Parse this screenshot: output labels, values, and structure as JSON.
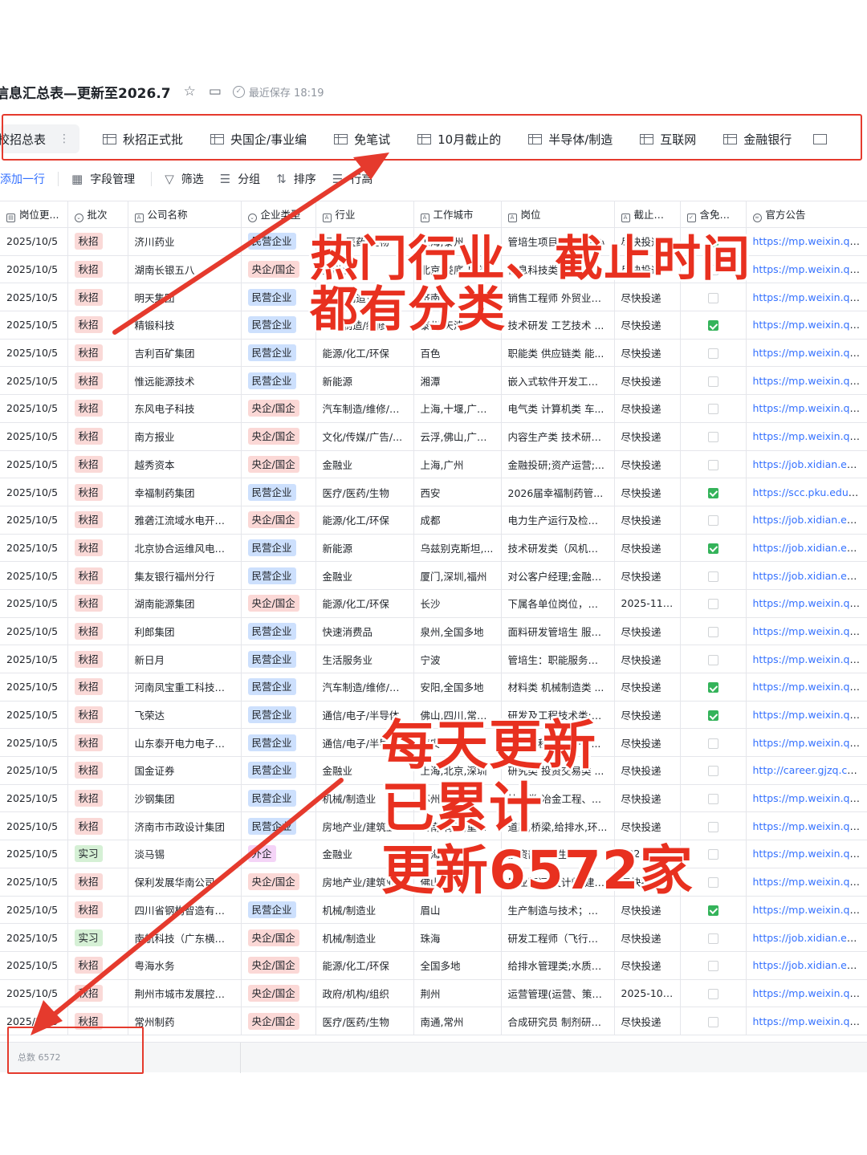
{
  "doc": {
    "title": "信息汇总表—更新至2026.7",
    "save_status": "最近保存 18:19"
  },
  "tabs": [
    {
      "label": "校招总表",
      "active": true
    },
    {
      "label": "秋招正式批"
    },
    {
      "label": "央国企/事业编"
    },
    {
      "label": "免笔试"
    },
    {
      "label": "10月截止的"
    },
    {
      "label": "半导体/制造"
    },
    {
      "label": "互联网"
    },
    {
      "label": "金融银行"
    }
  ],
  "toolbar": {
    "add_row": "添加一行",
    "field_manage": "字段管理",
    "filter": "筛选",
    "group": "分组",
    "sort": "排序",
    "row_height": "行高"
  },
  "columns": [
    "岗位更...",
    "批次",
    "公司名称",
    "企业类型",
    "行业",
    "工作城市",
    "岗位",
    "截止时间",
    "含免笔试",
    "官方公告"
  ],
  "rows": [
    {
      "date": "2025/10/5",
      "batch": "秋招",
      "company": "济川药业",
      "type": "民营企业",
      "industry": "医疗/医药/生物",
      "city": "上海,泰州",
      "position": "管培生项目; 生产中心",
      "deadline": "尽快投递",
      "free": true,
      "link": "https://mp.weixin.qq...."
    },
    {
      "date": "2025/10/5",
      "batch": "秋招",
      "company": "湖南长银五八",
      "type": "央企/国企",
      "industry": "金融业",
      "city": "北京,娄底,岳阳",
      "position": "信息科技类校招",
      "deadline": "尽快投递",
      "free": false,
      "link": "https://mp.weixin.qq...."
    },
    {
      "date": "2025/10/5",
      "batch": "秋招",
      "company": "明天集团",
      "type": "民营企业",
      "industry": "机械/制造业",
      "city": "济南",
      "position": "销售工程师 外贸业务...",
      "deadline": "尽快投递",
      "free": false,
      "link": "https://mp.weixin.qq...."
    },
    {
      "date": "2025/10/5",
      "batch": "秋招",
      "company": "精锻科技",
      "type": "民营企业",
      "industry": "汽车制造/维修",
      "city": "泰州,天津",
      "position": "技术研发 工艺技术 ...",
      "deadline": "尽快投递",
      "free": true,
      "link": "https://mp.weixin.qq...."
    },
    {
      "date": "2025/10/5",
      "batch": "秋招",
      "company": "吉利百矿集团",
      "type": "民营企业",
      "industry": "能源/化工/环保",
      "city": "百色",
      "position": "职能类 供应链类 能...",
      "deadline": "尽快投递",
      "free": false,
      "link": "https://mp.weixin.qq...."
    },
    {
      "date": "2025/10/5",
      "batch": "秋招",
      "company": "惟远能源技术",
      "type": "民营企业",
      "industry": "新能源",
      "city": "湘潭",
      "position": "嵌入式软件开发工程...",
      "deadline": "尽快投递",
      "free": false,
      "link": "https://mp.weixin.qq...."
    },
    {
      "date": "2025/10/5",
      "batch": "秋招",
      "company": "东风电子科技",
      "type": "央企/国企",
      "industry": "汽车制造/维修/零...",
      "city": "上海,十堰,广州...",
      "position": "电气类 计算机类 车...",
      "deadline": "尽快投递",
      "free": false,
      "link": "https://mp.weixin.qq...."
    },
    {
      "date": "2025/10/5",
      "batch": "秋招",
      "company": "南方报业",
      "type": "央企/国企",
      "industry": "文化/传媒/广告/...",
      "city": "云浮,佛山,广州...",
      "position": "内容生产类 技术研发...",
      "deadline": "尽快投递",
      "free": false,
      "link": "https://mp.weixin.qq...."
    },
    {
      "date": "2025/10/5",
      "batch": "秋招",
      "company": "越秀资本",
      "type": "央企/国企",
      "industry": "金融业",
      "city": "上海,广州",
      "position": "金融投研;资产运营;...",
      "deadline": "尽快投递",
      "free": false,
      "link": "https://job.xidian.edu..."
    },
    {
      "date": "2025/10/5",
      "batch": "秋招",
      "company": "幸福制药集团",
      "type": "民营企业",
      "industry": "医疗/医药/生物",
      "city": "西安",
      "position": "2026届幸福制药管...",
      "deadline": "尽快投递",
      "free": true,
      "link": "https://scc.pku.edu.c..."
    },
    {
      "date": "2025/10/5",
      "batch": "秋招",
      "company": "雅砻江流域水电开发...",
      "type": "央企/国企",
      "industry": "能源/化工/环保",
      "city": "成都",
      "position": "电力生产运行及检修...",
      "deadline": "尽快投递",
      "free": false,
      "link": "https://job.xidian.edu..."
    },
    {
      "date": "2025/10/5",
      "batch": "秋招",
      "company": "北京协合运维风电技...",
      "type": "民营企业",
      "industry": "新能源",
      "city": "乌兹别克斯坦,...",
      "position": "技术研发类（风机、...",
      "deadline": "尽快投递",
      "free": true,
      "link": "https://job.xidian.edu..."
    },
    {
      "date": "2025/10/5",
      "batch": "秋招",
      "company": "集友银行福州分行",
      "type": "民营企业",
      "industry": "金融业",
      "city": "厦门,深圳,福州",
      "position": "对公客户经理;金融市场",
      "deadline": "尽快投递",
      "free": false,
      "link": "https://job.xidian.edu..."
    },
    {
      "date": "2025/10/5",
      "batch": "秋招",
      "company": "湖南能源集团",
      "type": "央企/国企",
      "industry": "能源/化工/环保",
      "city": "长沙",
      "position": "下属各单位岗位，具...",
      "deadline": "2025-11-...",
      "free": false,
      "link": "https://mp.weixin.qq...."
    },
    {
      "date": "2025/10/5",
      "batch": "秋招",
      "company": "利郎集团",
      "type": "民营企业",
      "industry": "快速消费品",
      "city": "泉州,全国多地",
      "position": "面料研发管培生 服装...",
      "deadline": "尽快投递",
      "free": false,
      "link": "https://mp.weixin.qq...."
    },
    {
      "date": "2025/10/5",
      "batch": "秋招",
      "company": "新日月",
      "type": "民营企业",
      "industry": "生活服务业",
      "city": "宁波",
      "position": "管培生：职能服务类 ...",
      "deadline": "尽快投递",
      "free": false,
      "link": "https://mp.weixin.qq...."
    },
    {
      "date": "2025/10/5",
      "batch": "秋招",
      "company": "河南凤宝重工科技有...",
      "type": "民营企业",
      "industry": "汽车制造/维修/零...",
      "city": "安阳,全国多地",
      "position": "材料类 机械制造类 ...",
      "deadline": "尽快投递",
      "free": true,
      "link": "https://mp.weixin.qq...."
    },
    {
      "date": "2025/10/5",
      "batch": "秋招",
      "company": "飞荣达",
      "type": "民营企业",
      "industry": "通信/电子/半导体",
      "city": "佛山,四川,常州...",
      "position": "研发及工程技术类;支...",
      "deadline": "尽快投递",
      "free": true,
      "link": "https://mp.weixin.qq...."
    },
    {
      "date": "2025/10/5",
      "batch": "秋招",
      "company": "山东泰开电力电子有...",
      "type": "民营企业",
      "industry": "通信/电子/半导体",
      "city": "泰安",
      "position": "硬件工程师 软件工...",
      "deadline": "尽快投递",
      "free": false,
      "link": "https://mp.weixin.qq...."
    },
    {
      "date": "2025/10/5",
      "batch": "秋招",
      "company": "国金证券",
      "type": "民营企业",
      "industry": "金融业",
      "city": "上海,北京,深圳",
      "position": "研究类 投资交易类 ...",
      "deadline": "尽快投递",
      "free": false,
      "link": "http://career.gjzq.co..."
    },
    {
      "date": "2025/10/5",
      "batch": "秋招",
      "company": "沙钢集团",
      "type": "民营企业",
      "industry": "机械/制造业",
      "city": "苏州",
      "position": "技术类-冶金工程、...",
      "deadline": "尽快投递",
      "free": false,
      "link": "https://mp.weixin.qq...."
    },
    {
      "date": "2025/10/5",
      "batch": "秋招",
      "company": "济南市市政设计集团",
      "type": "民营企业",
      "industry": "房地产业/建筑业",
      "city": "济南,青岛,重庆...",
      "position": "道路,桥梁,给排水,环...",
      "deadline": "尽快投递",
      "free": false,
      "link": "https://mp.weixin.qq...."
    },
    {
      "date": "2025/10/5",
      "batch": "实习",
      "company": "淡马锡",
      "type": "外企",
      "industry": "金融业",
      "city": "上海",
      "position": "投资部实习生",
      "deadline": "2025-10-...",
      "free": false,
      "link": "https://mp.weixin.qq...."
    },
    {
      "date": "2025/10/5",
      "batch": "秋招",
      "company": "保利发展华南公司",
      "type": "央企/国企",
      "industry": "房地产业/建筑业",
      "city": "佛山,广州",
      "position": "置业顾问 设计师 建筑...",
      "deadline": "尽快投递",
      "free": false,
      "link": "https://mp.weixin.qq...."
    },
    {
      "date": "2025/10/5",
      "batch": "秋招",
      "company": "四川省钢构智造有限...",
      "type": "民营企业",
      "industry": "机械/制造业",
      "city": "眉山",
      "position": "生产制造与技术；安...",
      "deadline": "尽快投递",
      "free": true,
      "link": "https://mp.weixin.qq...."
    },
    {
      "date": "2025/10/5",
      "batch": "实习",
      "company": "南航科技（广东横琴...",
      "type": "央企/国企",
      "industry": "机械/制造业",
      "city": "珠海",
      "position": "研发工程师（飞行仿...",
      "deadline": "尽快投递",
      "free": false,
      "link": "https://job.xidian.edu..."
    },
    {
      "date": "2025/10/5",
      "batch": "秋招",
      "company": "粤海水务",
      "type": "央企/国企",
      "industry": "能源/化工/环保",
      "city": "全国多地",
      "position": "给排水管理类;水质管...",
      "deadline": "尽快投递",
      "free": false,
      "link": "https://job.xidian.edu..."
    },
    {
      "date": "2025/10/5",
      "batch": "秋招",
      "company": "荆州市城市发展控股...",
      "type": "央企/国企",
      "industry": "政府/机构/组织",
      "city": "荆州",
      "position": "运营管理(运营、策划...",
      "deadline": "2025-10-...",
      "free": false,
      "link": "https://mp.weixin.qq...."
    },
    {
      "date": "2025/10/5",
      "batch": "秋招",
      "company": "常州制药",
      "type": "央企/国企",
      "industry": "医疗/医药/生物",
      "city": "南通,常州",
      "position": "合成研究员 制剂研究...",
      "deadline": "尽快投递",
      "free": false,
      "link": "https://mp.weixin.qq...."
    }
  ],
  "footer": {
    "total_label": "总数 6572"
  },
  "annotations": {
    "top": [
      "热门行业、截止时间",
      "都有分类"
    ],
    "bottom": [
      "每天更新",
      "已累计",
      "更新6572家"
    ]
  },
  "colors": {
    "accent": "#3370ff",
    "annotation_red": "#e8301f",
    "checkbox_green": "#34b35a"
  }
}
